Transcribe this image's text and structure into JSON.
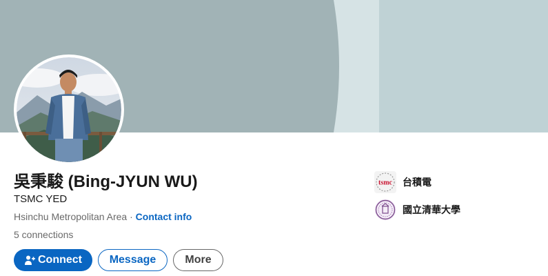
{
  "profile": {
    "name": "吳秉駿 (Bing-JYUN WU)",
    "headline": "TSMC YED",
    "location": "Hsinchu Metropolitan Area",
    "separator": " · ",
    "contact_info": "Contact info",
    "connections": "5 connections"
  },
  "actions": {
    "connect_label": "Connect",
    "message_label": "Message",
    "more_label": "More"
  },
  "organizations": [
    {
      "name": "台積電",
      "logo_text": "tsmc",
      "logo_icon": "tsmc-logo-icon"
    },
    {
      "name": "國立清華大學",
      "logo_icon": "university-seal-icon"
    }
  ],
  "colors": {
    "accent": "#0a66c2",
    "banner_left": "#a1b3b6",
    "banner_mid": "#d6e3e5",
    "banner_right": "#bfd2d5",
    "tsmc_red": "#c8102e",
    "nthu_purple": "#7b4a8c"
  }
}
